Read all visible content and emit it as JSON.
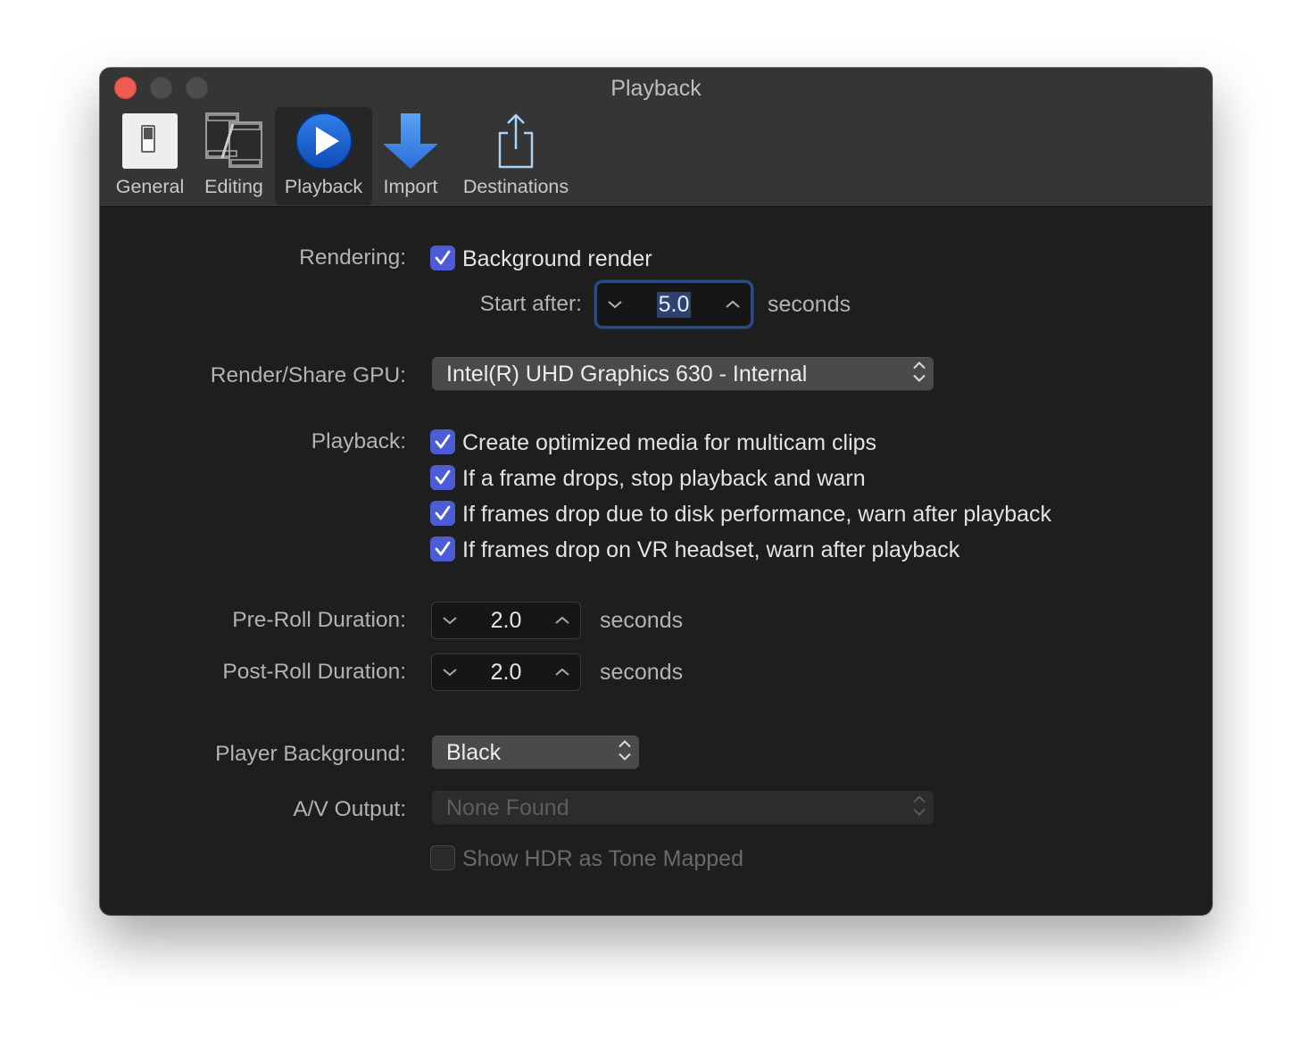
{
  "window": {
    "title": "Playback",
    "colors": {
      "close": "#ed5b52",
      "accent": "#4c5bd6",
      "focus_ring": "#2b4d86"
    }
  },
  "toolbar": {
    "tabs": [
      {
        "label": "General",
        "icon": "switch-icon"
      },
      {
        "label": "Editing",
        "icon": "film-clip-icon"
      },
      {
        "label": "Playback",
        "icon": "play-icon",
        "selected": true
      },
      {
        "label": "Import",
        "icon": "down-arrow-icon"
      },
      {
        "label": "Destinations",
        "icon": "share-icon"
      }
    ]
  },
  "rendering": {
    "label": "Rendering:",
    "background_render": {
      "label": "Background render",
      "checked": true
    },
    "start_after_label": "Start after:",
    "start_after_value": "5.0",
    "start_after_unit": "seconds"
  },
  "gpu": {
    "label": "Render/Share GPU:",
    "value": "Intel(R) UHD Graphics 630 - Internal"
  },
  "playback": {
    "label": "Playback:",
    "options": [
      {
        "label": "Create optimized media for multicam clips",
        "checked": true
      },
      {
        "label": "If a frame drops, stop playback and warn",
        "checked": true
      },
      {
        "label": "If frames drop due to disk performance, warn after playback",
        "checked": true
      },
      {
        "label": "If frames drop on VR headset, warn after playback",
        "checked": true
      }
    ]
  },
  "preroll": {
    "label": "Pre-Roll Duration:",
    "value": "2.0",
    "unit": "seconds"
  },
  "postroll": {
    "label": "Post-Roll Duration:",
    "value": "2.0",
    "unit": "seconds"
  },
  "player_background": {
    "label": "Player Background:",
    "value": "Black"
  },
  "av_output": {
    "label": "A/V Output:",
    "value": "None Found",
    "enabled": false
  },
  "hdr": {
    "label": "Show HDR as Tone Mapped",
    "checked": false,
    "enabled": false
  }
}
